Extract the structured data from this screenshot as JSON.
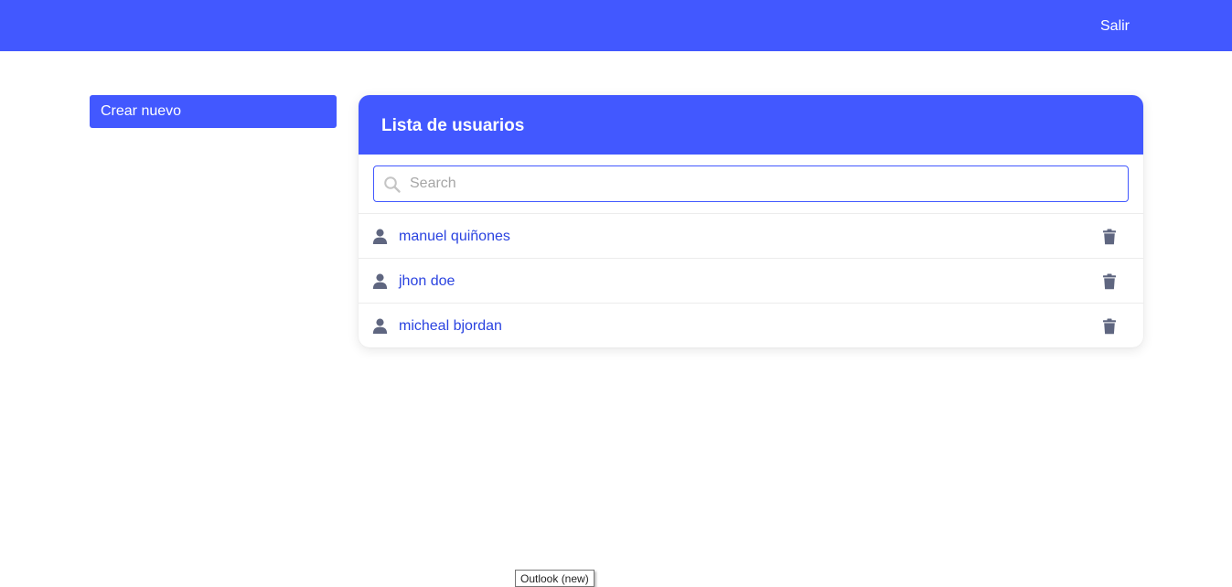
{
  "header": {
    "logout_label": "Salir",
    "background_color": "#4258ff"
  },
  "sidebar": {
    "create_label": "Crear nuevo"
  },
  "user_list": {
    "title": "Lista de usuarios",
    "search": {
      "placeholder": "Search",
      "value": "",
      "icon": "search-icon"
    },
    "users": [
      {
        "name": "manuel quiñones",
        "icon": "user-icon",
        "action_icon": "trash-icon"
      },
      {
        "name": "jhon doe",
        "icon": "user-icon",
        "action_icon": "trash-icon"
      },
      {
        "name": "micheal bjordan",
        "icon": "user-icon",
        "action_icon": "trash-icon"
      }
    ]
  },
  "tooltip": {
    "text": "Outlook (new)"
  },
  "colors": {
    "accent": "#4258ff",
    "link": "#2a43e0",
    "icon_gray": "#5f6680"
  }
}
